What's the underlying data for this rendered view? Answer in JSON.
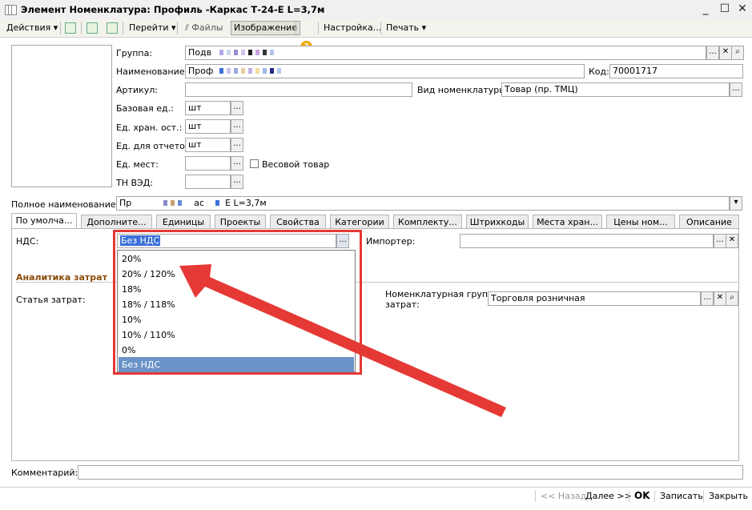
{
  "window": {
    "title": "Элемент Номенклатура: Профиль -Каркас Т-24-Е L=3,7м"
  },
  "toolbar": {
    "actions": "Действия",
    "goto": "Перейти",
    "files": "Файлы",
    "image": "Изображение",
    "help": "?",
    "settings": "Настройка...",
    "print": "Печать"
  },
  "form": {
    "group_label": "Группа:",
    "group_value": "Подв",
    "name_label": "Наименование:",
    "name_value": "Проф",
    "code_label": "Код:",
    "code_value": "70001717",
    "article_label": "Артикул:",
    "article_value": "",
    "kind_label": "Вид номенклатуры:",
    "kind_value": "Товар (пр. ТМЦ)",
    "base_unit_label": "Базовая ед.:",
    "base_unit_value": "шт",
    "storage_unit_label": "Ед. хран. ост.:",
    "storage_unit_value": "шт",
    "report_unit_label": "Ед. для отчетов:",
    "report_unit_value": "шт",
    "place_unit_label": "Ед. мест:",
    "place_unit_value": "",
    "weight_label": "Весовой товар",
    "tnved_label": "ТН ВЭД:",
    "tnved_value": "",
    "full_name_label": "Полное наименование:",
    "full_name_value_a": "Пр",
    "full_name_value_b": "ас",
    "full_name_value_c": "Е L=3,7м",
    "comment_label": "Комментарий:",
    "comment_value": ""
  },
  "tabs": [
    "По умолча...",
    "Дополните...",
    "Единицы",
    "Проекты",
    "Свойства",
    "Категории",
    "Комплекту...",
    "Штрихкоды",
    "Места хран...",
    "Цены ном...",
    "Описание"
  ],
  "tab_default": {
    "vat_label": "НДС:",
    "vat_value": "Без НДС",
    "importer_label": "Импортер:",
    "importer_value": "",
    "section_label": "Аналитика затрат",
    "cost_item_label": "Статья затрат:",
    "nom_group_label_1": "Номенклатурная группа",
    "nom_group_label_2": "затрат:",
    "nom_group_value": "Торговля розничная"
  },
  "vat_options": [
    "20%",
    "20% / 120%",
    "18%",
    "18% / 118%",
    "10%",
    "10% / 110%",
    "0%",
    "Без НДС"
  ],
  "vat_selected_index": 7,
  "footer": {
    "back": "<< Назад",
    "next": "Далее >>",
    "ok": "OK",
    "save": "Записать",
    "close": "Закрыть"
  },
  "colors": {
    "annotation": "#e53935",
    "selection": "#6a93c8",
    "section_title": "#8a4a0a"
  }
}
